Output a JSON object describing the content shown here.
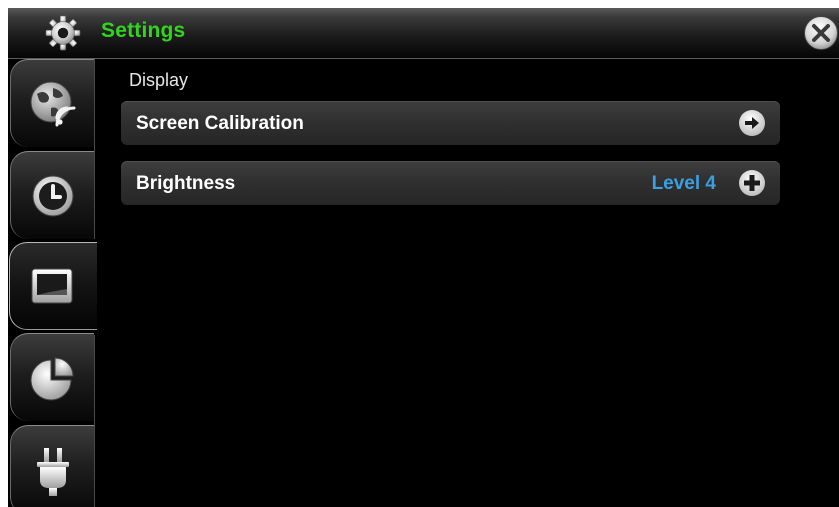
{
  "window": {
    "title": "Settings",
    "title_color": "#33d41f",
    "title_icon": "gear-icon",
    "close_icon": "close-icon"
  },
  "sidebar": {
    "tabs": [
      {
        "name": "network",
        "icon": "globe-wifi-icon",
        "active": false
      },
      {
        "name": "time",
        "icon": "clock-icon",
        "active": false
      },
      {
        "name": "display",
        "icon": "monitor-icon",
        "active": true
      },
      {
        "name": "storage",
        "icon": "pie-chart-icon",
        "active": false
      },
      {
        "name": "power",
        "icon": "power-plug-icon",
        "active": false
      }
    ]
  },
  "main": {
    "section_title": "Display",
    "rows": [
      {
        "label": "Screen Calibration",
        "value": "",
        "icon": "arrow-right-icon"
      },
      {
        "label": "Brightness",
        "value": "Level 4",
        "value_color": "#3b9fe0",
        "icon": "plus-icon"
      }
    ]
  }
}
